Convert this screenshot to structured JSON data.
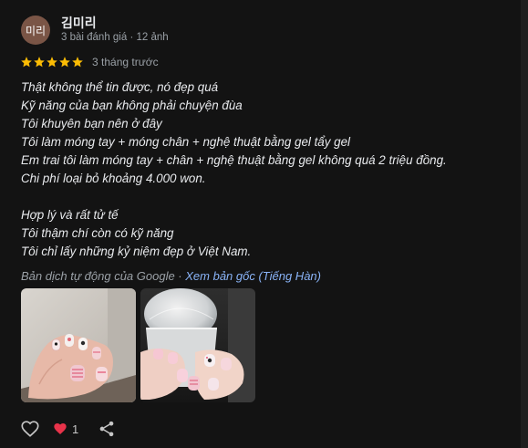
{
  "reviewer": {
    "avatar_text": "미리",
    "name": "김미리",
    "meta": "3 bài đánh giá · 12 ảnh",
    "avatar_color": "#7a5546"
  },
  "rating": {
    "stars": 5,
    "time": "3 tháng trước",
    "star_color": "#fbbc04"
  },
  "review_lines": [
    "Thật không thể tin được, nó đẹp quá",
    "Kỹ năng của bạn không phải chuyện đùa",
    "Tôi khuyên bạn nên ở đây",
    "Tôi làm móng tay + móng chân + nghệ thuật bằng gel tẩy gel",
    "Em trai tôi làm móng tay + chân + nghệ thuật bằng gel không quá 2 triệu đồng.",
    "Chi phí loại bỏ khoảng 4.000 won.",
    "",
    "Hợp lý và rất tử tế",
    "Tôi thậm chí còn có kỹ năng",
    "Tôi chỉ lấy những kỷ niệm đẹp ở Việt Nam."
  ],
  "translation": {
    "note": "Bản dịch tự động của Google · ",
    "link": "Xem bản gốc (Tiếng Hàn)",
    "link_color": "#8ab4f8"
  },
  "photos": [
    {
      "name": "nail-photo-1"
    },
    {
      "name": "nail-photo-2"
    }
  ],
  "actions": {
    "like_icon": "heart-outline-icon",
    "loved_icon": "heart-filled-icon",
    "loved_count": "1",
    "share_icon": "share-icon",
    "heart_color": "#e8334a"
  }
}
